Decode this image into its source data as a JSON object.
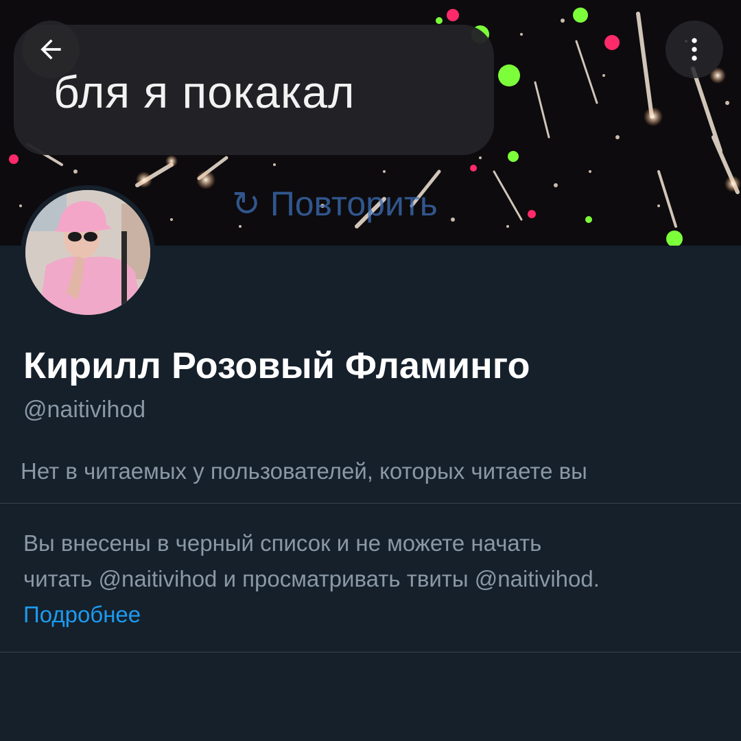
{
  "banner": {
    "message_text": "бля я покакал",
    "retry_text": "Повторить"
  },
  "header": {
    "back_icon": "arrow-left-icon",
    "menu_icon": "more-vertical-icon"
  },
  "profile": {
    "display_name": "Кирилл Розовый Фламинго",
    "handle": "@naitivihod",
    "follow_note": "Нет в читаемых у пользователей, которых читаете вы",
    "blocked_line1": "Вы внесены в черный список и не можете начать",
    "blocked_line2": "читать @naitivihod и просматривать твиты @naitivihod.",
    "learn_more": "Подробнее"
  },
  "colors": {
    "background": "#15202b",
    "secondary_text": "#8b98a5",
    "link": "#1d9bf0",
    "divider": "#38444d"
  }
}
